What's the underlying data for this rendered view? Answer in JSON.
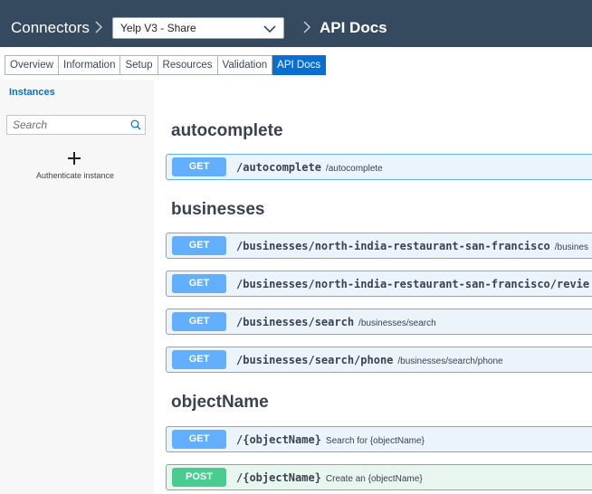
{
  "header": {
    "brand": "Connectors",
    "connector_select_value": "Yelp V3 - Share",
    "breadcrumb": "API Docs",
    "background_color": "#354a5f"
  },
  "tabs": [
    {
      "label": "Overview",
      "active": false
    },
    {
      "label": "Information",
      "active": false
    },
    {
      "label": "Setup",
      "active": false
    },
    {
      "label": "Resources",
      "active": false
    },
    {
      "label": "Validation",
      "active": false
    },
    {
      "label": "API Docs",
      "active": true
    }
  ],
  "sidebar": {
    "title": "Instances",
    "search_placeholder": "Search",
    "add_label": "Authenticate instance",
    "icons": {
      "search": "search-icon",
      "add": "plus-icon"
    }
  },
  "sections": [
    {
      "name": "autocomplete",
      "operations": [
        {
          "method": "GET",
          "path": "/autocomplete",
          "summary": "/autocomplete"
        }
      ]
    },
    {
      "name": "businesses",
      "operations": [
        {
          "method": "GET",
          "path": "/businesses/north-india-restaurant-san-francisco",
          "summary": "/busines"
        },
        {
          "method": "GET",
          "path": "/businesses/north-india-restaurant-san-francisco/revie",
          "summary": ""
        },
        {
          "method": "GET",
          "path": "/businesses/search",
          "summary": "/businesses/search"
        },
        {
          "method": "GET",
          "path": "/businesses/search/phone",
          "summary": "/businesses/search/phone"
        }
      ]
    },
    {
      "name": "objectName",
      "operations": [
        {
          "method": "GET",
          "path": "/{objectName}",
          "summary": "Search for {objectName}"
        },
        {
          "method": "POST",
          "path": "/{objectName}",
          "summary": "Create an {objectName}"
        }
      ]
    }
  ],
  "colors": {
    "get": "#61affe",
    "post": "#49cc90",
    "active_tab": "#0a6ed1"
  }
}
